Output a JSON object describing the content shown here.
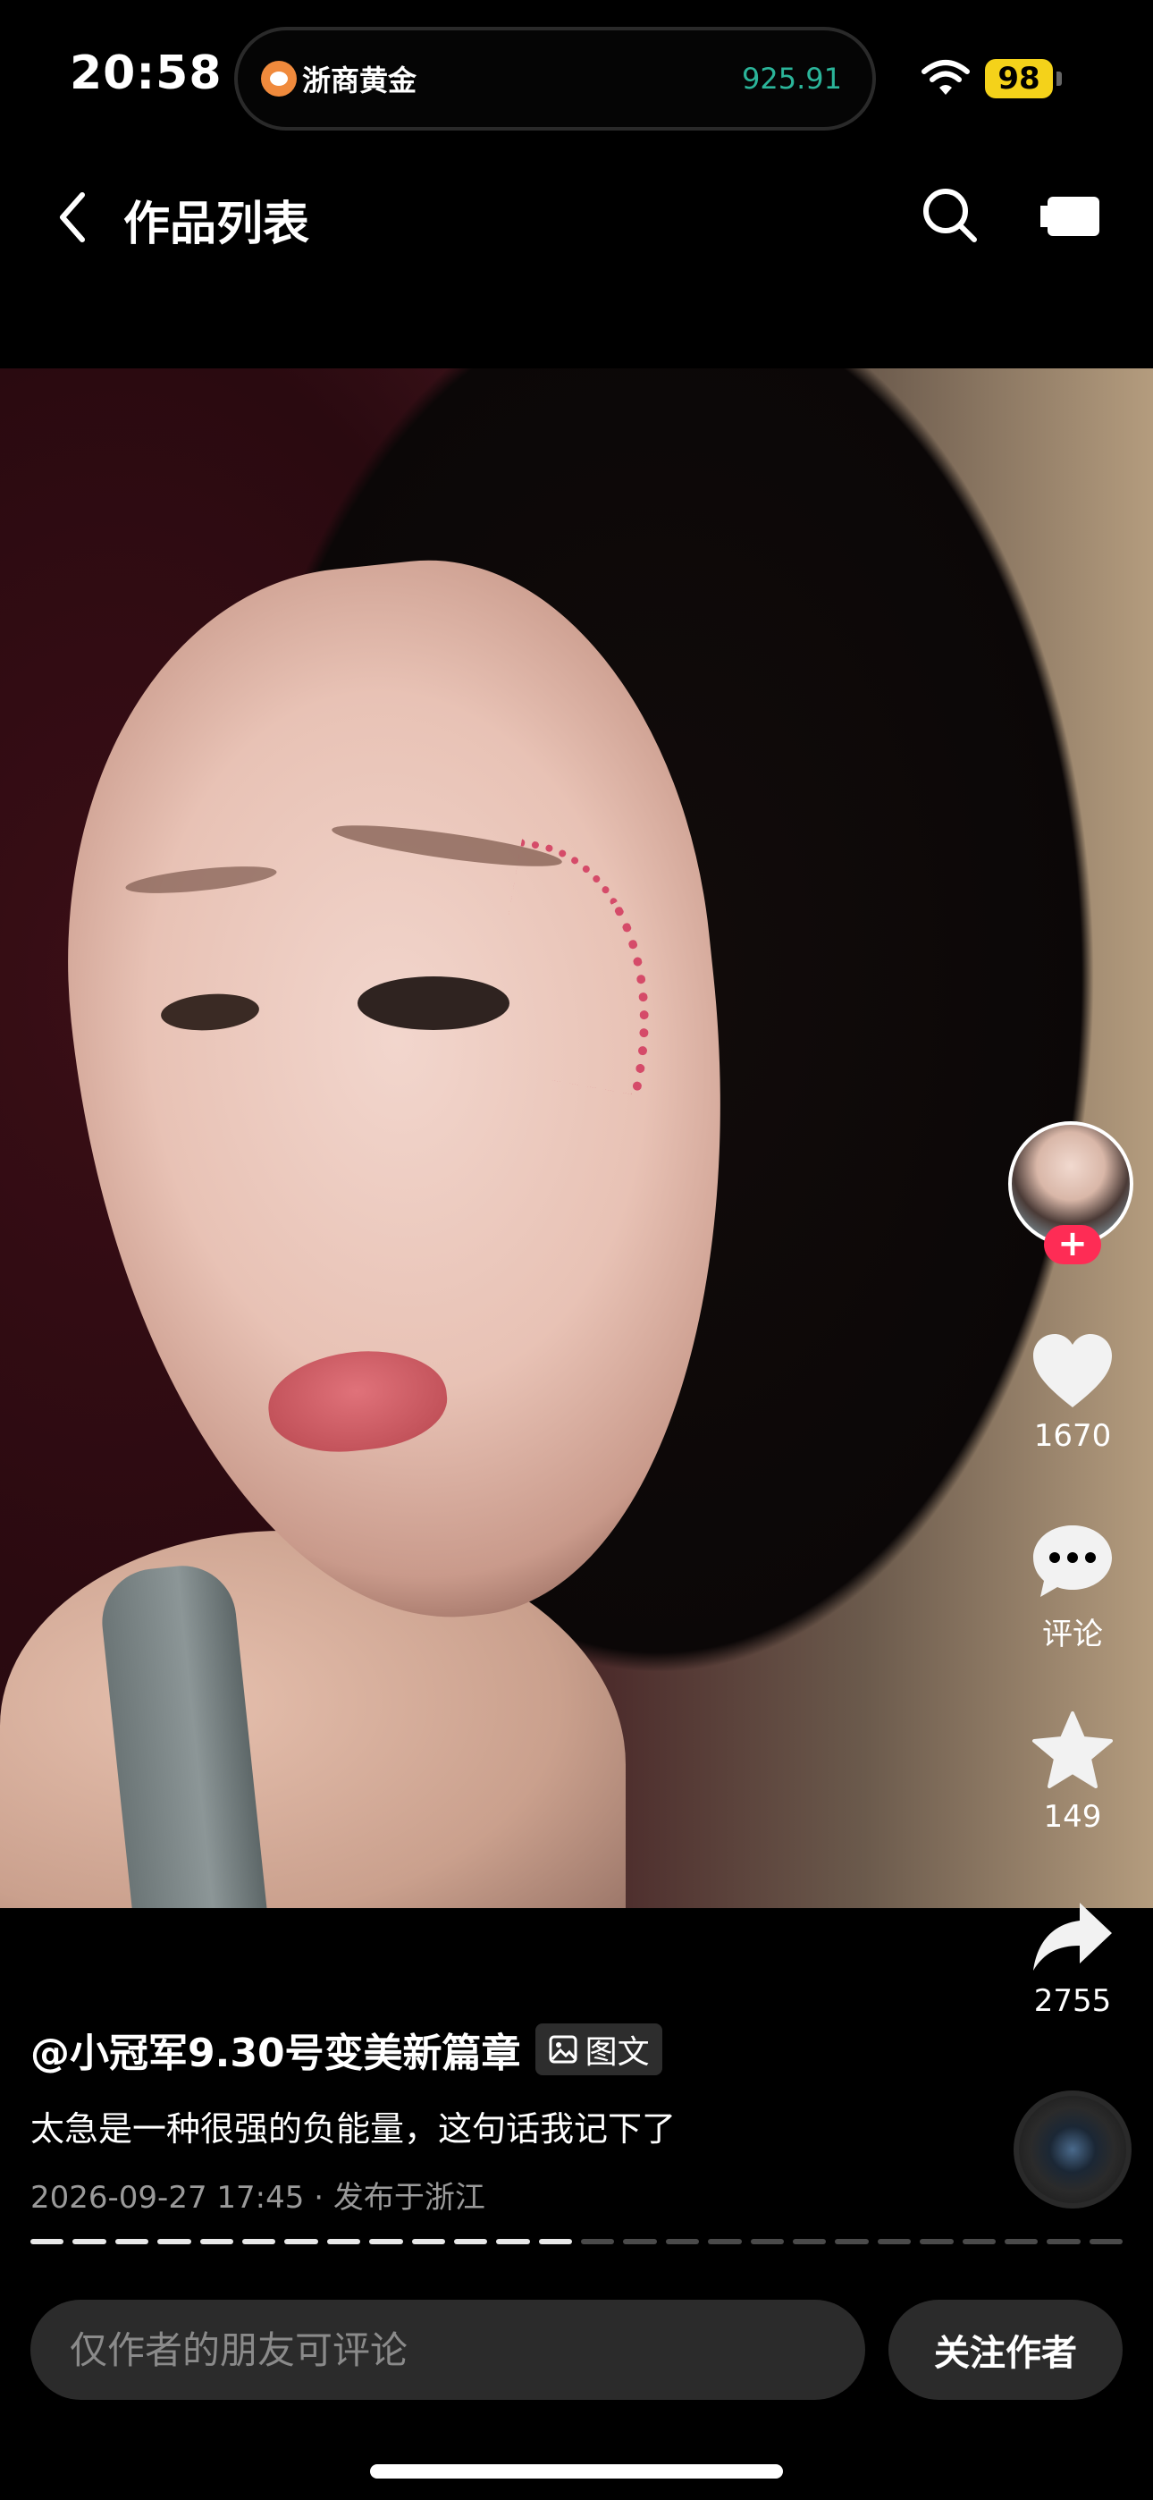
{
  "status_bar": {
    "time": "20:58",
    "island_title": "浙商黄金",
    "island_value": "925.91",
    "battery": "98"
  },
  "nav": {
    "title": "作品列表"
  },
  "actions": {
    "like_count": "1670",
    "comment_label": "评论",
    "favorite_count": "149",
    "share_count": "2755",
    "follow_plus": "+"
  },
  "post": {
    "author": "@小冠军9.30号变美新篇章",
    "type_badge": "图文",
    "caption": "太急是一种很强的负能量，这句话我记下了",
    "date": "2026-09-27 17:45",
    "location": "· 发布于浙江",
    "progress_segments_total": 26,
    "progress_segments_done": 13
  },
  "bottom": {
    "comment_placeholder": "仅作者的朋友可评论",
    "follow_label": "关注作者"
  },
  "colors": {
    "accent_red": "#fe2c55",
    "gold_value": "#2bb59a",
    "battery": "#f4d21a"
  }
}
